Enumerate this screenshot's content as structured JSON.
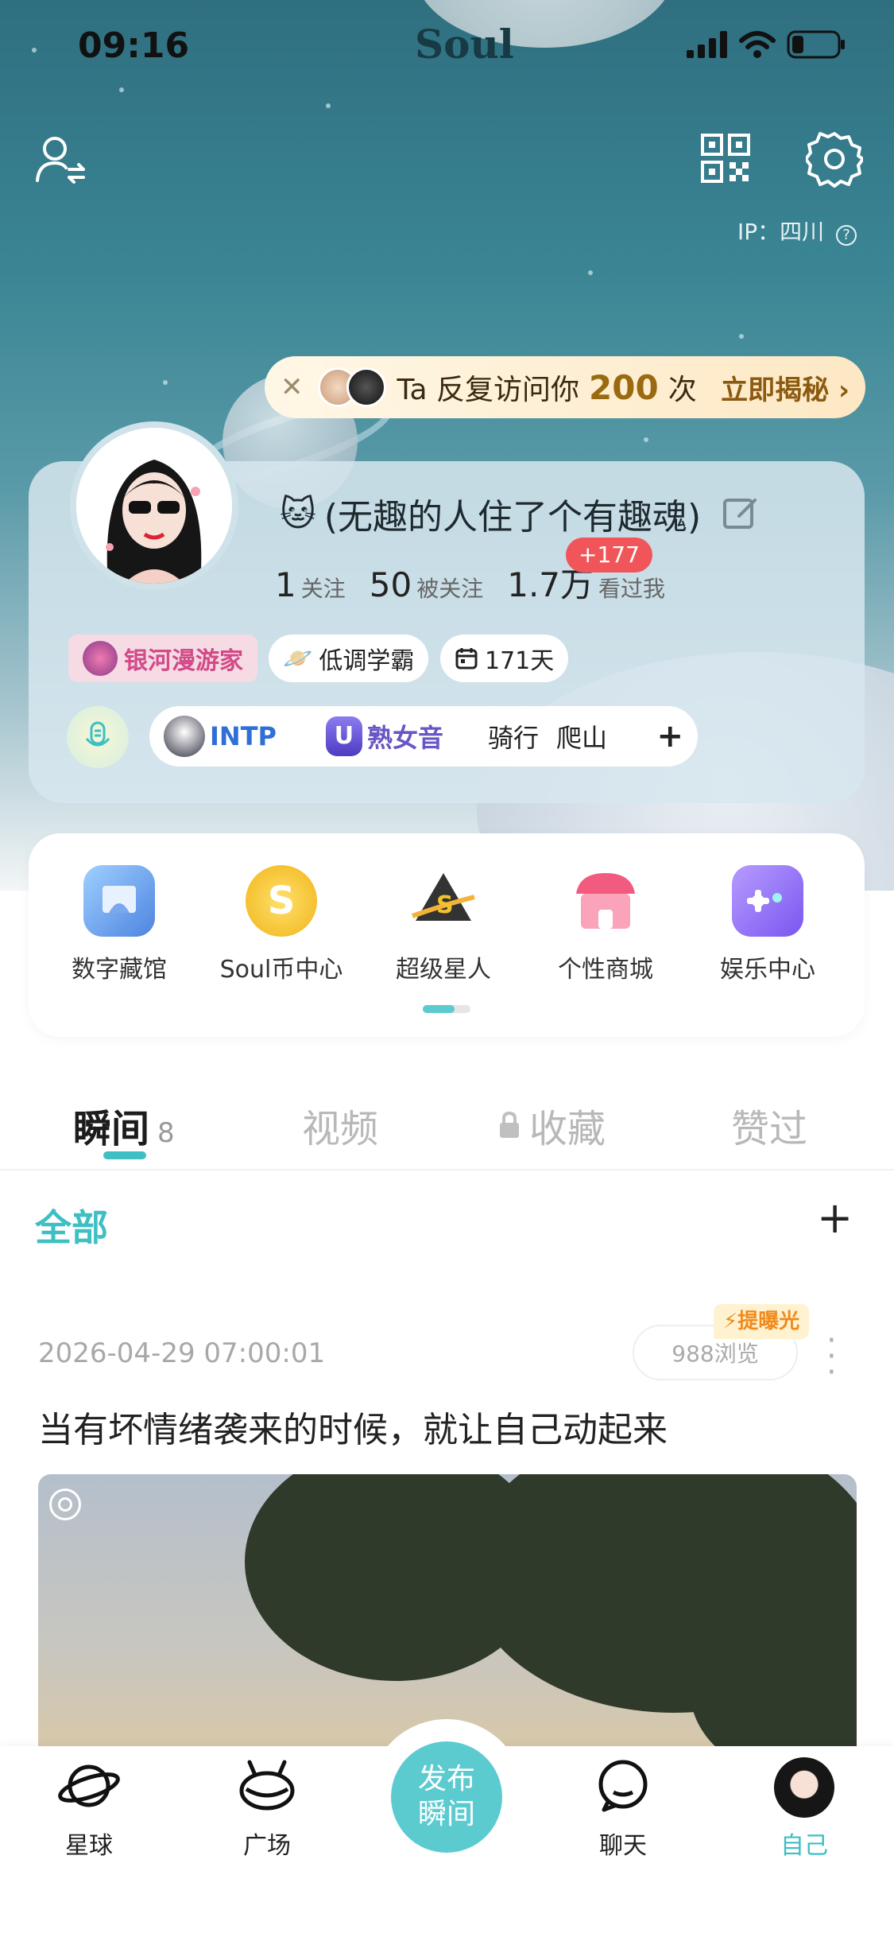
{
  "status_bar": {
    "time": "09:16",
    "brand": "Soul"
  },
  "header": {
    "ip_label": "IP：四川"
  },
  "visitor_banner": {
    "prefix": "Ta 反复访问你",
    "count": "200",
    "suffix": "次",
    "cta": "立即揭秘"
  },
  "profile": {
    "nickname": "(无趣的人住了个有趣魂)",
    "following_count": "1",
    "following_label": "关注",
    "followers_count": "50",
    "followers_label": "被关注",
    "viewed_count": "1.7万",
    "viewed_label": "看过我",
    "viewed_increment": "+177",
    "badges": [
      {
        "label": "银河漫游家"
      },
      {
        "label": "低调学霸"
      },
      {
        "label": "171天"
      }
    ],
    "tags": [
      "INTP",
      "熟女音",
      "骑行",
      "爬山"
    ]
  },
  "services": [
    {
      "label": "数字藏馆",
      "icon": "digital-collection-icon",
      "color": "#6aa6e8"
    },
    {
      "label": "Soul币中心",
      "icon": "soul-coin-icon",
      "color": "#f3c22e"
    },
    {
      "label": "超级星人",
      "icon": "super-star-icon",
      "color": "#3a3a3a"
    },
    {
      "label": "个性商城",
      "icon": "shop-icon",
      "color": "#f25b7f"
    },
    {
      "label": "娱乐中心",
      "icon": "game-controller-icon",
      "color": "#8c6cf0"
    }
  ],
  "tabs": [
    {
      "label": "瞬间",
      "count": "8"
    },
    {
      "label": "视频"
    },
    {
      "label": "收藏"
    },
    {
      "label": "赞过"
    }
  ],
  "filter": {
    "label": "全部"
  },
  "post": {
    "date": "2026-04-29 07:00:01",
    "views": "988浏览",
    "boost": "提曝光",
    "text": "当有坏情绪袭来的时候，就让自己动起来"
  },
  "bottom_nav": [
    {
      "label": "星球"
    },
    {
      "label": "广场"
    },
    {
      "label": "聊天"
    },
    {
      "label": "自己"
    }
  ],
  "publish": {
    "line1": "发布",
    "line2": "瞬间"
  },
  "colors": {
    "accent": "#3dbfc4",
    "badge_red": "#f0555a"
  }
}
